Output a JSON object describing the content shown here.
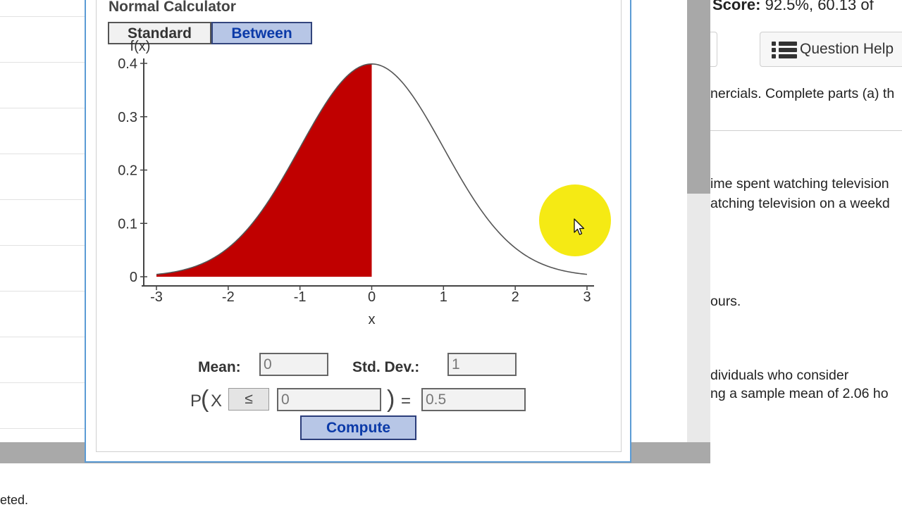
{
  "background": {
    "bottom_text": "eted.",
    "score_label": "Score:",
    "score_value": " 92.5%, 60.13 of",
    "question_help_label": "Question Help",
    "text_lines": [
      "nercials. Complete parts (a) th",
      "ime spent watching television",
      "atching television on a weekd",
      "ours.",
      "dividuals who consider",
      "ng a sample mean of 2.06 ho"
    ]
  },
  "calculator": {
    "title": "Normal Calculator",
    "tabs": [
      {
        "label": "Standard",
        "selected": false
      },
      {
        "label": "Between",
        "selected": true
      }
    ],
    "mean_label": "Mean:",
    "mean_value": "0",
    "std_label": "Std. Dev.:",
    "std_value": "1",
    "p_label": "P",
    "variable": "X",
    "open_paren": "(",
    "close_paren": ")",
    "equals": "=",
    "operator": "≤",
    "x_value": "0",
    "probability": "0.5",
    "compute_label": "Compute"
  },
  "chart_data": {
    "type": "area",
    "distribution": "normal",
    "mean": 0,
    "std": 1,
    "shaded_region": {
      "from": -3,
      "to": 0,
      "color": "#c00000"
    },
    "curve_color": "#555555",
    "xlabel": "x",
    "ylabel": "f(x)",
    "xlim": [
      -3,
      3
    ],
    "ylim": [
      0,
      0.4
    ],
    "xticks": [
      "-3",
      "-2",
      "-1",
      "0",
      "1",
      "2",
      "3"
    ],
    "yticks": [
      "0",
      "0.1",
      "0.2",
      "0.3",
      "0.4"
    ]
  }
}
